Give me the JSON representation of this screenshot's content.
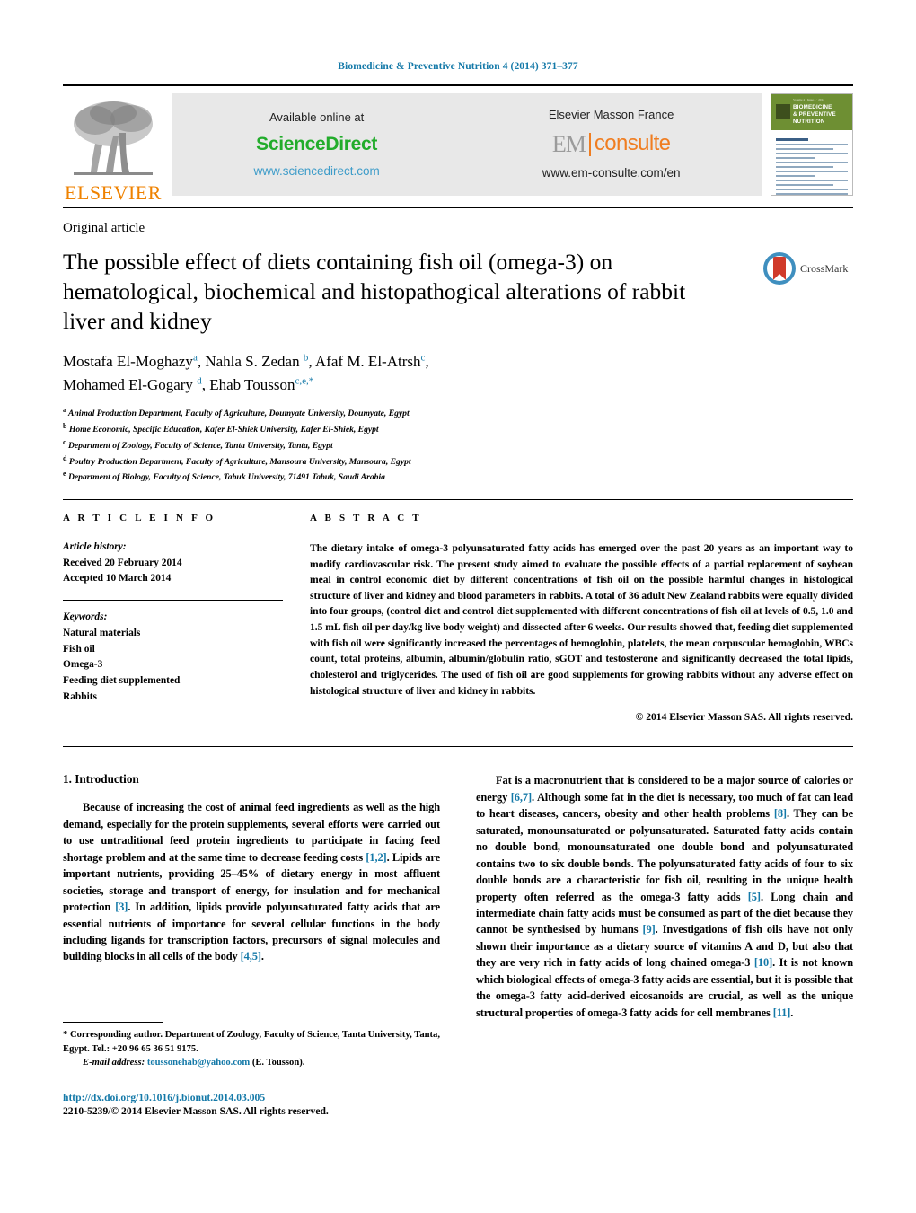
{
  "running_head": "Biomedicine & Preventive Nutrition 4 (2014) 371–377",
  "masthead": {
    "elsevier_wordmark": "ELSEVIER",
    "sciencedirect": {
      "available_label": "Available online at",
      "brand": "ScienceDirect",
      "url": "www.sciencedirect.com"
    },
    "emconsulte": {
      "publisher_label": "Elsevier Masson France",
      "brand_left": "EM",
      "brand_right": "consulte",
      "url": "www.em-consulte.com/en"
    },
    "cover": {
      "title_line1": "BIOMEDICINE",
      "title_line2": "& PREVENTIVE NUTRITION",
      "top_line": "Volume 4 · Issue 4 · 2014"
    },
    "colors": {
      "sciencedirect_green": "#22ac2b",
      "emconsulte_orange": "#f07d20",
      "elsevier_orange": "#ef8200",
      "link_blue": "#1479a8",
      "cover_green": "#6e8f33"
    }
  },
  "article": {
    "type": "Original article",
    "title": "The possible effect of diets containing fish oil (omega-3) on hematological, biochemical and histopathogical alterations of rabbit liver and kidney",
    "crossmark_label": "CrossMark",
    "authors_line1_pre": "Mostafa El-Moghazy",
    "authors": [
      {
        "name": "Mostafa El-Moghazy",
        "sup": "a"
      },
      {
        "name": "Nahla S. Zedan",
        "sup": "b"
      },
      {
        "name": "Afaf M. El-Atrsh",
        "sup": "c"
      },
      {
        "name": "Mohamed El-Gogary",
        "sup": "d"
      },
      {
        "name": "Ehab Tousson",
        "sup": "c,e,*"
      }
    ],
    "affiliations": [
      {
        "mark": "a",
        "text": "Animal Production Department, Faculty of Agriculture, Doumyate University, Doumyate, Egypt"
      },
      {
        "mark": "b",
        "text": "Home Economic, Specific Education, Kafer El-Shiek University, Kafer El-Shiek, Egypt"
      },
      {
        "mark": "c",
        "text": "Department of Zoology, Faculty of Science, Tanta University, Tanta, Egypt"
      },
      {
        "mark": "d",
        "text": "Poultry Production Department, Faculty of Agriculture, Mansoura University, Mansoura, Egypt"
      },
      {
        "mark": "e",
        "text": "Department of Biology, Faculty of Science, Tabuk University, 71491 Tabuk, Saudi Arabia"
      }
    ]
  },
  "article_info": {
    "heading": "A R T I C L E   I N F O",
    "history_label": "Article history:",
    "received": "Received 20 February 2014",
    "accepted": "Accepted 10 March 2014",
    "keywords_label": "Keywords:",
    "keywords": [
      "Natural materials",
      "Fish oil",
      "Omega-3",
      "Feeding diet supplemented",
      "Rabbits"
    ]
  },
  "abstract": {
    "heading": "A B S T R A C T",
    "text": "The dietary intake of omega-3 polyunsaturated fatty acids has emerged over the past 20 years as an important way to modify cardiovascular risk. The present study aimed to evaluate the possible effects of a partial replacement of soybean meal in control economic diet by different concentrations of fish oil on the possible harmful changes in histological structure of liver and kidney and blood parameters in rabbits. A total of 36 adult New Zealand rabbits were equally divided into four groups, (control diet and control diet supplemented with different concentrations of fish oil at levels of 0.5, 1.0 and 1.5 mL fish oil per day/kg live body weight) and dissected after 6 weeks. Our results showed that, feeding diet supplemented with fish oil were significantly increased the percentages of hemoglobin, platelets, the mean corpuscular hemoglobin, WBCs count, total proteins, albumin, albumin/globulin ratio, sGOT and testosterone and significantly decreased the total lipids, cholesterol and triglycerides. The used of fish oil are good supplements for growing rabbits without any adverse effect on histological structure of liver and kidney in rabbits.",
    "copyright": "© 2014 Elsevier Masson SAS. All rights reserved."
  },
  "body": {
    "section_heading": "1. Introduction",
    "left_paragraph_parts": [
      {
        "t": "Because of increasing the cost of animal feed ingredients as well as the high demand, especially for the protein supplements, several efforts were carried out to use untraditional feed protein ingredients to participate in facing feed shortage problem and at the same time to decrease feeding costs "
      },
      {
        "t": "[1,2]",
        "ref": true
      },
      {
        "t": ". Lipids are important nutrients, providing 25–45% of dietary energy in most affluent societies, storage and transport of energy, for insulation and for mechanical protection "
      },
      {
        "t": "[3]",
        "ref": true
      },
      {
        "t": ". In addition, lipids provide polyunsaturated fatty acids that are essential nutrients of importance for several cellular functions in the body including ligands for transcription factors, precursors of signal molecules and building blocks in all cells of the body "
      },
      {
        "t": "[4,5]",
        "ref": true
      },
      {
        "t": "."
      }
    ],
    "right_paragraph_parts": [
      {
        "t": "Fat is a macronutrient that is considered to be a major source of calories or energy "
      },
      {
        "t": "[6,7]",
        "ref": true
      },
      {
        "t": ". Although some fat in the diet is necessary, too much of fat can lead to heart diseases, cancers, obesity and other health problems "
      },
      {
        "t": "[8]",
        "ref": true
      },
      {
        "t": ". They can be saturated, monounsaturated or polyunsaturated. Saturated fatty acids contain no double bond, monounsaturated one double bond and polyunsaturated contains two to six double bonds. The polyunsaturated fatty acids of four to six double bonds are a characteristic for fish oil, resulting in the unique health property often referred as the omega-3 fatty acids "
      },
      {
        "t": "[5]",
        "ref": true
      },
      {
        "t": ". Long chain and intermediate chain fatty acids must be consumed as part of the diet because they cannot be synthesised by humans "
      },
      {
        "t": "[9]",
        "ref": true
      },
      {
        "t": ". Investigations of fish oils have not only shown their importance as a dietary source of vitamins A and D, but also that they are very rich in fatty acids of long chained omega-3 "
      },
      {
        "t": "[10]",
        "ref": true
      },
      {
        "t": ". It is not known which biological effects of omega-3 fatty acids are essential, but it is possible that the omega-3 fatty acid-derived eicosanoids are crucial, as well as the unique structural properties of omega-3 fatty acids for cell membranes "
      },
      {
        "t": "[11]",
        "ref": true
      },
      {
        "t": "."
      }
    ]
  },
  "footer": {
    "corresponding_star": "*",
    "corresponding_text": "Corresponding author. Department of Zoology, Faculty of Science, Tanta University, Tanta, Egypt. Tel.: +20 96 65 36 51 9175.",
    "email_label": "E-mail address:",
    "email": "toussonehab@yahoo.com",
    "email_suffix": "(E. Tousson).",
    "doi": "http://dx.doi.org/10.1016/j.bionut.2014.03.005",
    "issn_line": "2210-5239/© 2014 Elsevier Masson SAS. All rights reserved."
  }
}
